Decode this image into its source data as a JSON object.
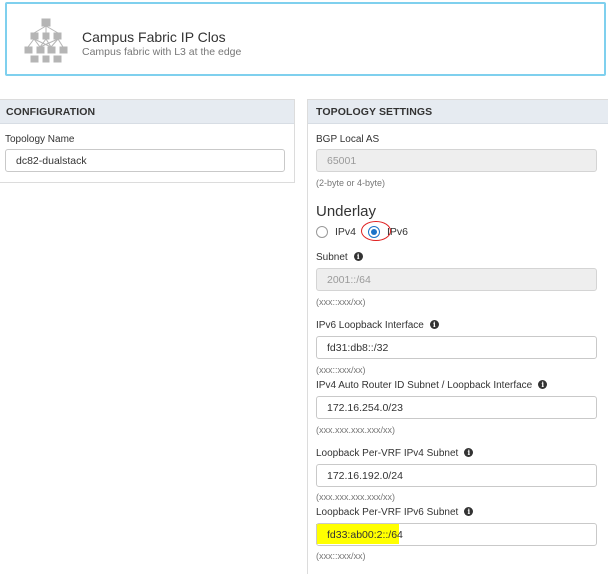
{
  "header": {
    "title": "Campus Fabric IP Clos",
    "subtitle": "Campus fabric with L3 at the edge",
    "icon": "topology-icon"
  },
  "configuration": {
    "heading": "CONFIGURATION",
    "topology_name_label": "Topology Name",
    "topology_name_value": "dc82-dualstack"
  },
  "topology_settings": {
    "heading": "TOPOLOGY SETTINGS",
    "bgp_label": "BGP Local AS",
    "bgp_value": "65001",
    "bgp_hint": "(2-byte or 4-byte)",
    "underlay_title": "Underlay",
    "underlay_options": [
      "IPv4",
      "IPv6"
    ],
    "underlay_selected": "IPv6",
    "subnet_label": "Subnet",
    "subnet_value": "2001::/64",
    "subnet_hint": "(xxx::xxx/xx)",
    "ipv6_loopback_label": "IPv6 Loopback Interface",
    "ipv6_loopback_value": "fd31:db8::/32",
    "ipv6_loopback_hint": "(xxx::xxx/xx)",
    "ipv4_router_label": "IPv4 Auto Router ID Subnet / Loopback Interface",
    "ipv4_router_value": "172.16.254.0/23",
    "ipv4_router_hint": "(xxx.xxx.xxx.xxx/xx)",
    "vrf_ipv4_label": "Loopback Per-VRF IPv4 Subnet",
    "vrf_ipv4_value": "172.16.192.0/24",
    "vrf_ipv4_hint": "(xxx.xxx.xxx.xxx/xx)",
    "vrf_ipv6_label": "Loopback Per-VRF IPv6 Subnet",
    "vrf_ipv6_value": "fd33:ab00:2::/64",
    "vrf_ipv6_hint": "(xxx::xxx/xx)"
  },
  "colors": {
    "header_border": "#7fd0ee",
    "panel_header_bg": "#e6ebf1",
    "radio_selected": "#1a73c8",
    "annotation_circle": "#e02020",
    "highlight": "#ffff00"
  }
}
